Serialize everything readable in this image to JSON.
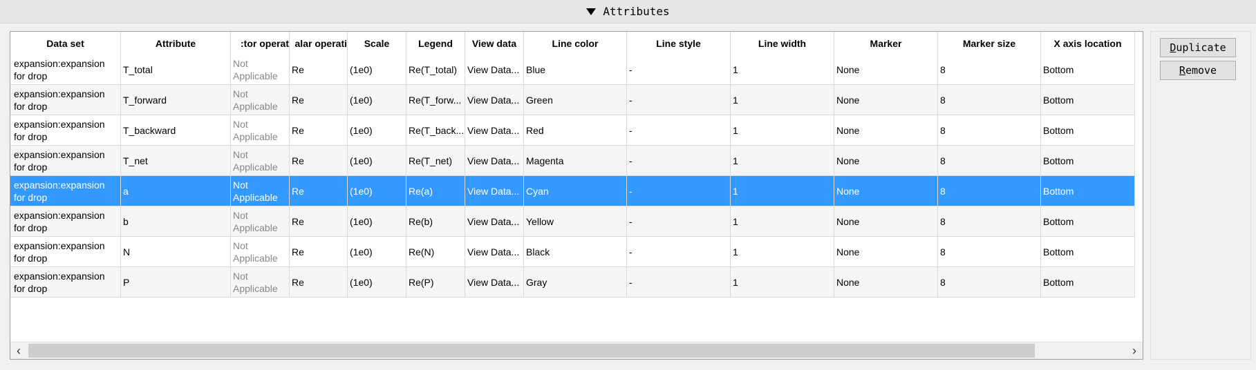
{
  "header": {
    "title": "Attributes",
    "toggle_icon": "triangle-down-icon"
  },
  "table": {
    "columns": [
      "Data set",
      "Attribute",
      ":tor operat",
      "alar operati",
      "Scale",
      "Legend",
      "View data",
      "Line color",
      "Line style",
      "Line width",
      "Marker",
      "Marker size",
      "X axis location"
    ],
    "rows": [
      {
        "dataset": "expansion:expansion for drop",
        "attribute": "T_total",
        "vector_op": "Not Applicable",
        "scalar_op": "Re",
        "scale": "(1e0)",
        "legend": "Re(T_total)",
        "view": "View Data...",
        "color": "Blue",
        "style": "-",
        "width": "1",
        "marker": "None",
        "msize": "8",
        "xaxis": "Bottom"
      },
      {
        "dataset": "expansion:expansion for drop",
        "attribute": "T_forward",
        "vector_op": "Not Applicable",
        "scalar_op": "Re",
        "scale": "(1e0)",
        "legend": "Re(T_forw...",
        "view": "View Data...",
        "color": "Green",
        "style": "-",
        "width": "1",
        "marker": "None",
        "msize": "8",
        "xaxis": "Bottom"
      },
      {
        "dataset": "expansion:expansion for drop",
        "attribute": "T_backward",
        "vector_op": "Not Applicable",
        "scalar_op": "Re",
        "scale": "(1e0)",
        "legend": "Re(T_back...",
        "view": "View Data...",
        "color": "Red",
        "style": "-",
        "width": "1",
        "marker": "None",
        "msize": "8",
        "xaxis": "Bottom"
      },
      {
        "dataset": "expansion:expansion for drop",
        "attribute": "T_net",
        "vector_op": "Not Applicable",
        "scalar_op": "Re",
        "scale": "(1e0)",
        "legend": "Re(T_net)",
        "view": "View Data...",
        "color": "Magenta",
        "style": "-",
        "width": "1",
        "marker": "None",
        "msize": "8",
        "xaxis": "Bottom"
      },
      {
        "dataset": "expansion:expansion for drop",
        "attribute": "a",
        "vector_op": "Not Applicable",
        "scalar_op": "Re",
        "scale": "(1e0)",
        "legend": "Re(a)",
        "view": "View Data...",
        "color": "Cyan",
        "style": "-",
        "width": "1",
        "marker": "None",
        "msize": "8",
        "xaxis": "Bottom",
        "selected": true
      },
      {
        "dataset": "expansion:expansion for drop",
        "attribute": "b",
        "vector_op": "Not Applicable",
        "scalar_op": "Re",
        "scale": "(1e0)",
        "legend": "Re(b)",
        "view": "View Data...",
        "color": "Yellow",
        "style": "-",
        "width": "1",
        "marker": "None",
        "msize": "8",
        "xaxis": "Bottom"
      },
      {
        "dataset": "expansion:expansion for drop",
        "attribute": "N",
        "vector_op": "Not Applicable",
        "scalar_op": "Re",
        "scale": "(1e0)",
        "legend": "Re(N)",
        "view": "View Data...",
        "color": "Black",
        "style": "-",
        "width": "1",
        "marker": "None",
        "msize": "8",
        "xaxis": "Bottom"
      },
      {
        "dataset": "expansion:expansion for drop",
        "attribute": "P",
        "vector_op": "Not Applicable",
        "scalar_op": "Re",
        "scale": "(1e0)",
        "legend": "Re(P)",
        "view": "View Data...",
        "color": "Gray",
        "style": "-",
        "width": "1",
        "marker": "None",
        "msize": "8",
        "xaxis": "Bottom"
      }
    ],
    "selected_color": "#3399ff"
  },
  "scrollbar": {
    "left_icon": "chevron-left-icon",
    "right_icon": "chevron-right-icon"
  },
  "buttons": {
    "duplicate": {
      "mnemonic": "D",
      "rest": "uplicate"
    },
    "remove": {
      "mnemonic": "R",
      "rest": "emove"
    }
  }
}
